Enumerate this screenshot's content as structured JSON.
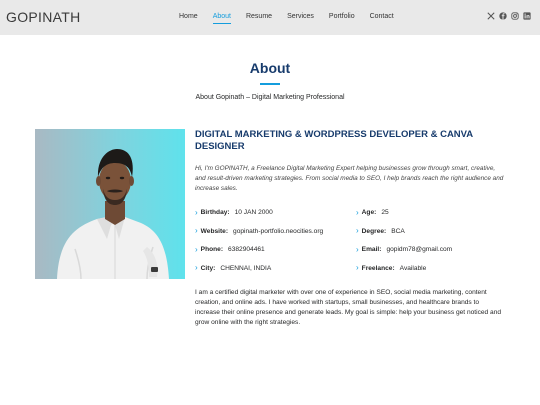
{
  "header": {
    "logo": "GOPINATH",
    "nav": [
      {
        "label": "Home",
        "active": false
      },
      {
        "label": "About",
        "active": true
      },
      {
        "label": "Resume",
        "active": false
      },
      {
        "label": "Services",
        "active": false
      },
      {
        "label": "Portfolio",
        "active": false
      },
      {
        "label": "Contact",
        "active": false
      }
    ],
    "socials": [
      "x-twitter-icon",
      "facebook-icon",
      "instagram-icon",
      "linkedin-icon"
    ]
  },
  "about": {
    "title": "About",
    "subtitle": "About Gopinath – Digital Marketing Professional",
    "role": "DIGITAL MARKETING & WORDPRESS DEVELOPER & CANVA DESIGNER",
    "intro": "Hi, I'm GOPINATH, a Freelance Digital Marketing Expert helping businesses grow through smart, creative, and result-driven marketing strategies. From social media to SEO, I help brands reach the right audience and increase sales.",
    "info_left": [
      {
        "label": "Birthday:",
        "value": "10 JAN 2000"
      },
      {
        "label": "Website:",
        "value": "gopinath-portfolio.neocities.org"
      },
      {
        "label": "Phone:",
        "value": "6382904461"
      },
      {
        "label": "City:",
        "value": "CHENNAI, INDIA"
      }
    ],
    "info_right": [
      {
        "label": "Age:",
        "value": "25"
      },
      {
        "label": "Degree:",
        "value": "BCA"
      },
      {
        "label": "Email:",
        "value": "gopidm78@gmail.com"
      },
      {
        "label": "Freelance:",
        "value": "Available"
      }
    ],
    "bio": "I am a certified digital marketer with over one of experience in SEO, social media marketing, content creation, and online ads. I have worked with startups, small businesses, and healthcare brands to increase their online presence and generate leads. My goal is simple: help your business get noticed and grow online with the right strategies."
  },
  "colors": {
    "accent": "#149ddd",
    "heading": "#173b6c",
    "header_bg": "#e9e9e9"
  }
}
